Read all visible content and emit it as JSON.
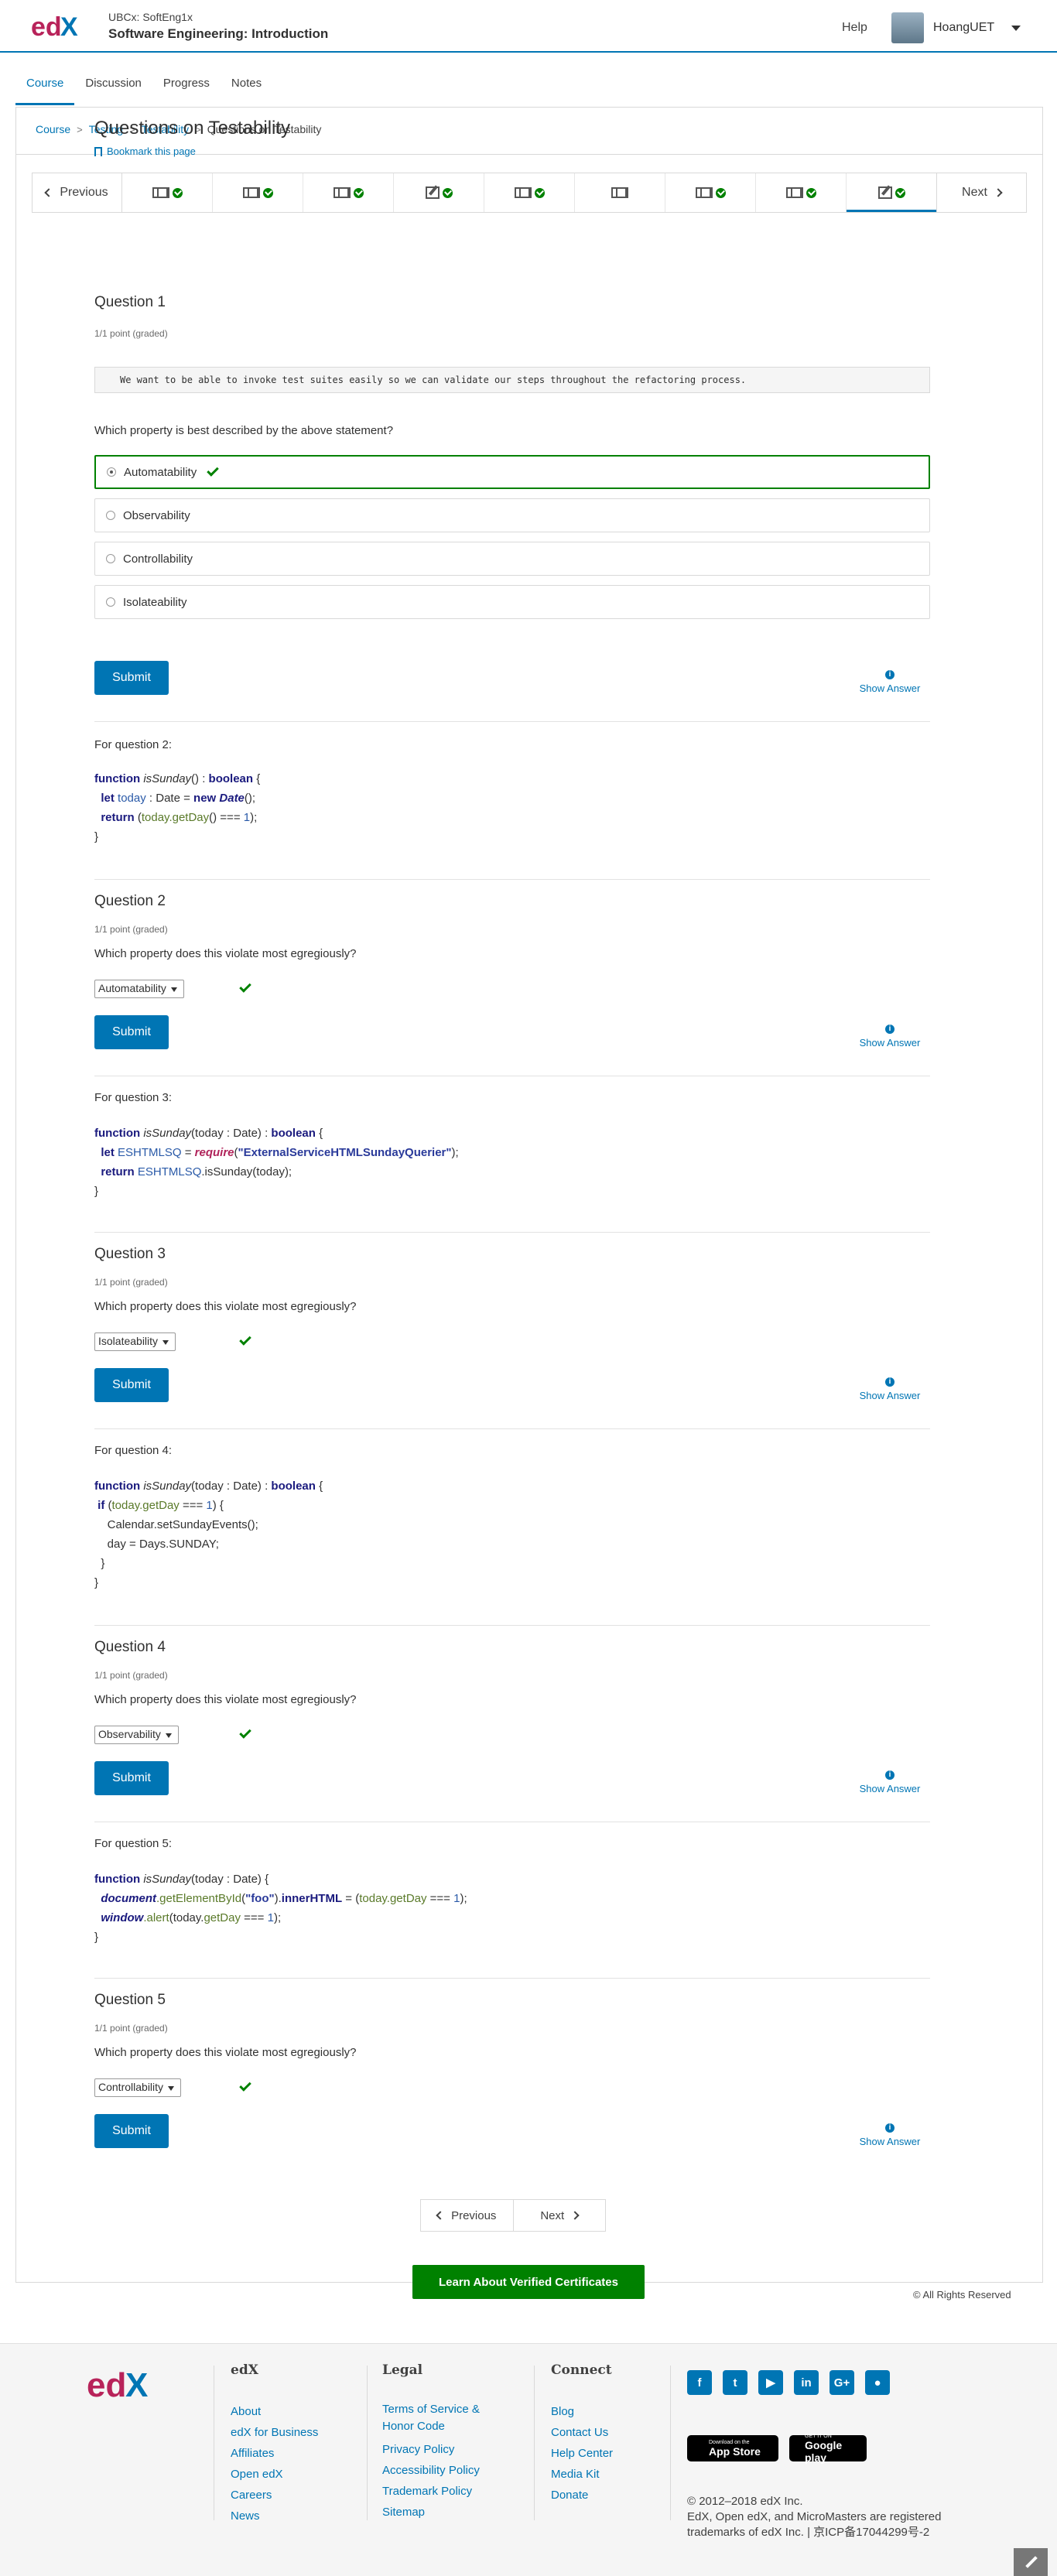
{
  "header": {
    "course_org": "UBCx: SoftEng1x",
    "course_name": "Software Engineering: Introduction",
    "help": "Help",
    "username": "HoangUET"
  },
  "tabs": [
    {
      "label": "Course",
      "active": true
    },
    {
      "label": "Discussion"
    },
    {
      "label": "Progress"
    },
    {
      "label": "Notes"
    }
  ],
  "breadcrumb": [
    "Course",
    "Testing",
    "Testability",
    "Questions on Testability"
  ],
  "sequence": {
    "previous": "Previous",
    "next": "Next",
    "items": [
      {
        "icon": "video-icon",
        "done": true
      },
      {
        "icon": "video-icon",
        "done": true
      },
      {
        "icon": "video-icon",
        "done": true
      },
      {
        "icon": "problem-icon",
        "done": true
      },
      {
        "icon": "video-icon",
        "done": true
      },
      {
        "icon": "video-icon",
        "done": false
      },
      {
        "icon": "video-icon",
        "done": true
      },
      {
        "icon": "video-icon",
        "done": true
      },
      {
        "icon": "problem-icon",
        "done": true,
        "active": true
      }
    ]
  },
  "unit": {
    "title": "Questions on Testability",
    "bookmark": "Bookmark this page"
  },
  "q1": {
    "title": "Question 1",
    "points": "1/1 point (graded)",
    "statement": "We want to be able to invoke test suites easily so we can validate our steps throughout the refactoring process.",
    "prompt": "Which property is best described by the above statement?",
    "choices": [
      "Automatability",
      "Observability",
      "Controllability",
      "Isolateability"
    ],
    "selected": "Automatability"
  },
  "submit_label": "Submit",
  "show_answer_label": "Show Answer",
  "code_q2": {
    "intro": "For question 2:",
    "l1_kw": "function",
    "l1_fn": "isSunday",
    "l1_rest": "() : ",
    "l1_type": "boolean",
    "l1_end": " {",
    "l2_kw": "let",
    "l2_var": "today",
    "l2_mid": " : Date = ",
    "l2_new": "new",
    "l2_cls": "Date",
    "l2_end": "();",
    "l3_kw": "return",
    "l3_a": " (",
    "l3_b": "today.getDay",
    "l3_c": "() === ",
    "l3_d": "1",
    "l3_e": ");",
    "l4": "}"
  },
  "q2": {
    "title": "Question 2",
    "points": "1/1 point (graded)",
    "prompt": "Which property does this violate most egregiously?",
    "answer": "Automatability"
  },
  "code_q3": {
    "intro": "For question 3:",
    "l1_kw": "function",
    "l1_fn": "isSunday",
    "l1_rest": "(today : Date) : ",
    "l1_type": "boolean",
    "l1_end": " {",
    "l2_kw": "let",
    "l2_var": "ESHTMLSQ",
    "l2_eq": " = ",
    "l2_req": "require",
    "l2_p1": "(",
    "l2_str": "\"ExternalServiceHTMLSundayQuerier\"",
    "l2_p2": ");",
    "l3_kw": "return",
    "l3_var": "ESHTMLSQ",
    "l3_rest": ".isSunday(today);",
    "l4": "}"
  },
  "q3": {
    "title": "Question 3",
    "points": "1/1 point (graded)",
    "prompt": "Which property does this violate most egregiously?",
    "answer": "Isolateability"
  },
  "code_q4": {
    "intro": "For question 4:",
    "l1_kw": "function",
    "l1_fn": "isSunday",
    "l1_rest": "(today : Date) : ",
    "l1_type": "boolean",
    "l1_end": " {",
    "l2_kw": "if",
    "l2_a": " (",
    "l2_b": "today.getDay",
    "l2_c": " === ",
    "l2_d": "1",
    "l2_e": ") {",
    "l3": "Calendar.setSundayEvents();",
    "l4": "day = Days.SUNDAY;",
    "l5": "}",
    "l6": "}"
  },
  "q4": {
    "title": "Question 4",
    "points": "1/1 point (graded)",
    "prompt": "Which property does this violate most egregiously?",
    "answer": "Observability"
  },
  "code_q5": {
    "intro": "For question 5:",
    "l1_kw": "function",
    "l1_fn": "isSunday",
    "l1_rest": "(today : Date) {",
    "l2_obj": "document",
    "l2_m": ".getElementById",
    "l2_p": "(",
    "l2_str": "\"foo\"",
    "l2_q": ").",
    "l2_prop": "innerHTML",
    "l2_r": " = (",
    "l2_s": "today.getDay",
    "l2_t": " === ",
    "l2_u": "1",
    "l2_v": ");",
    "l3_obj": "window",
    "l3_m": ".alert",
    "l3_r": "(today.",
    "l3_s": "getDay",
    "l3_t": " === ",
    "l3_u": "1",
    "l3_v": ");",
    "l4": "}"
  },
  "q5": {
    "title": "Question 5",
    "points": "1/1 point (graded)",
    "prompt": "Which property does this violate most egregiously?",
    "answer": "Controllability"
  },
  "bottom_nav": {
    "previous": "Previous",
    "next": "Next"
  },
  "verified_button": "Learn About Verified Certificates",
  "rights": "© All Rights Reserved",
  "footer": {
    "edx": {
      "heading": "edX",
      "links": [
        "About",
        "edX for Business",
        "Affiliates",
        "Open edX",
        "Careers",
        "News"
      ]
    },
    "legal": {
      "heading": "Legal",
      "links": [
        "Terms of Service & Honor Code",
        "Privacy Policy",
        "Accessibility Policy",
        "Trademark Policy",
        "Sitemap"
      ]
    },
    "connect": {
      "heading": "Connect",
      "links": [
        "Blog",
        "Contact Us",
        "Help Center",
        "Media Kit",
        "Donate"
      ]
    },
    "app_store": {
      "small": "Download on the",
      "big": "App Store"
    },
    "google_play": {
      "small": "GET IT ON",
      "big": "Google play"
    },
    "copyright": "© 2012–2018 edX Inc.",
    "trademark": "EdX, Open edX, and MicroMasters are registered trademarks of edX Inc. | 京ICP备17044299号-2"
  },
  "colors": {
    "brand_blue": "#0075b4",
    "success_green": "#008100"
  }
}
